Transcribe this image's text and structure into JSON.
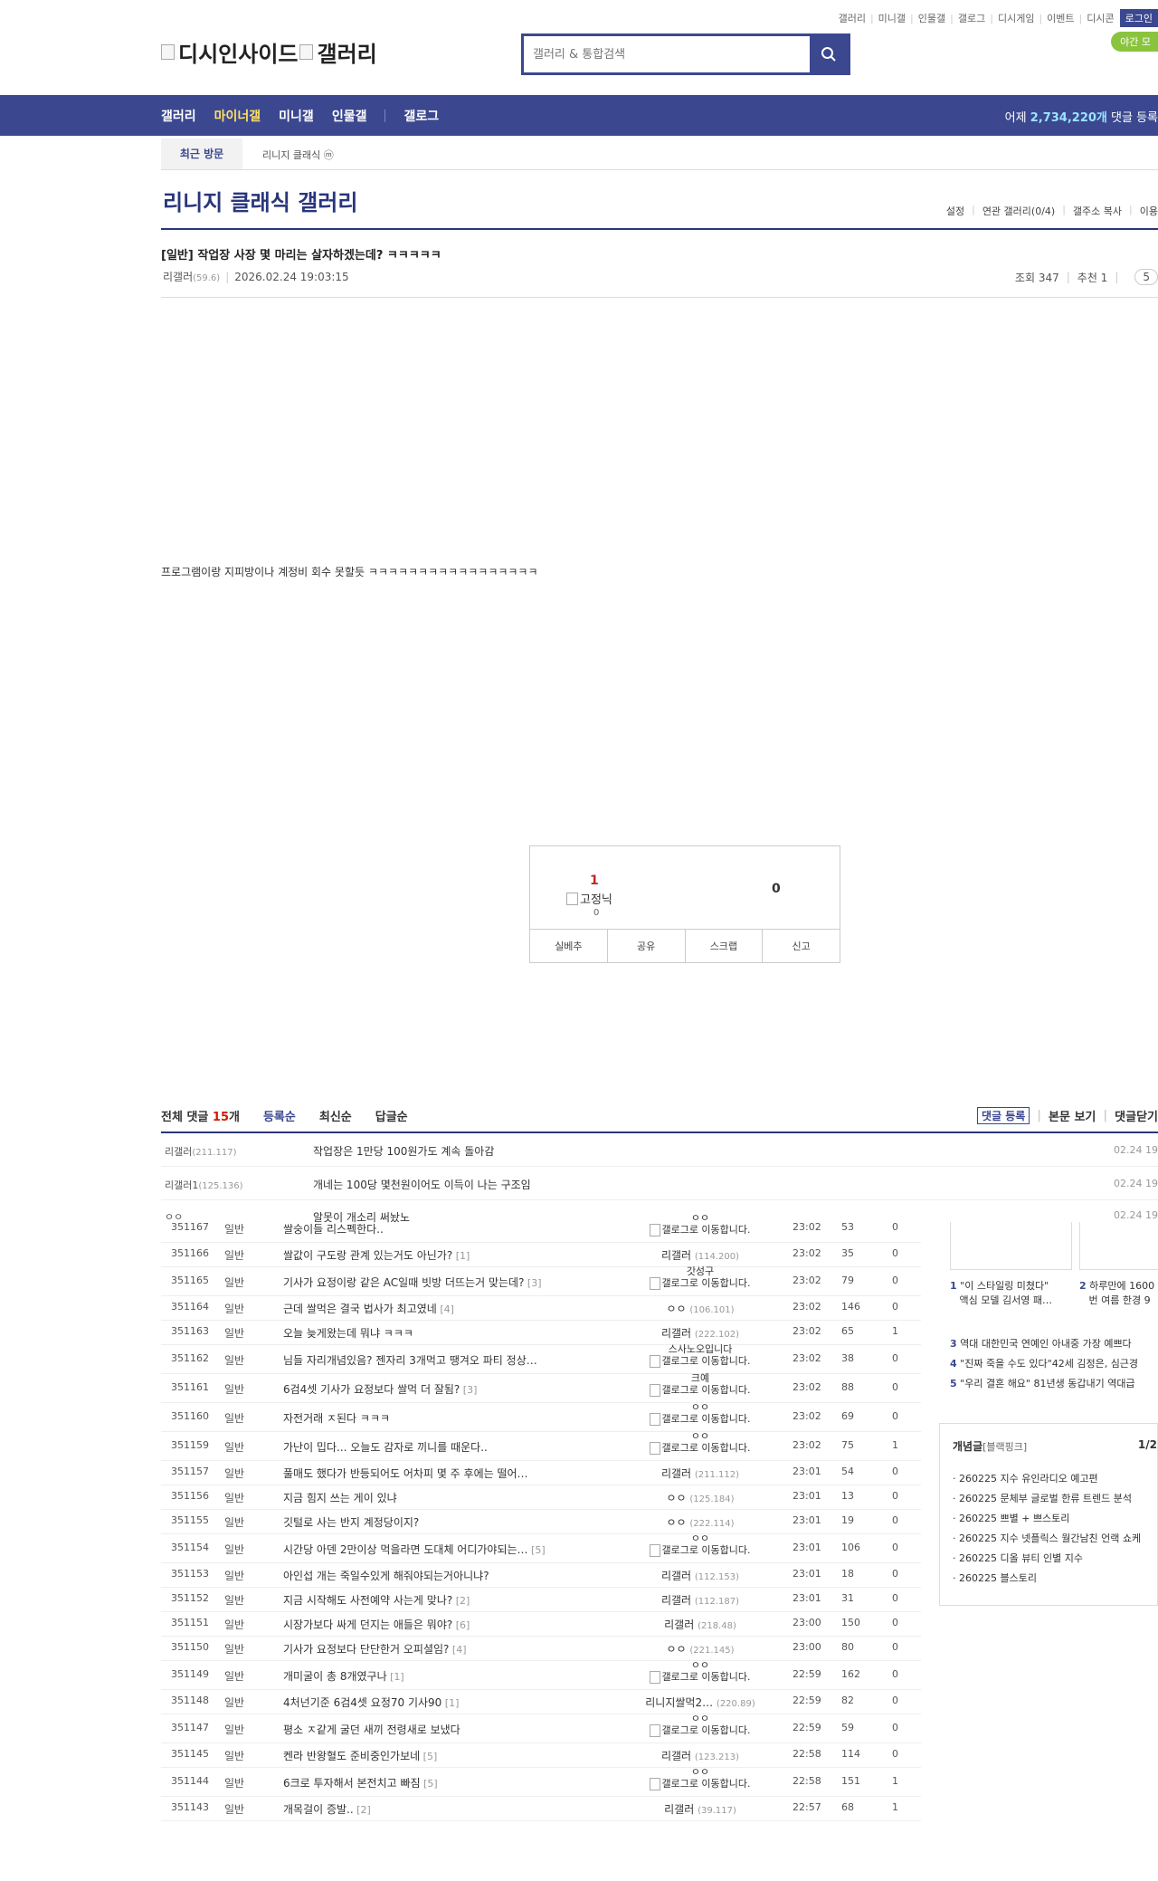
{
  "header": {
    "util_links": [
      "갤러리",
      "미니갤",
      "인물갤",
      "갤로그",
      "디시게임",
      "이벤트",
      "디시콘"
    ],
    "login_label": "로그인",
    "night_mode_label": "야간 모",
    "logo_left": "디시인사이드",
    "logo_right": "갤러리",
    "search_placeholder": "갤러리 & 통합검색"
  },
  "gnb": {
    "items": [
      "갤러리",
      "마이너갤",
      "미니갤",
      "인물갤",
      "갤로그"
    ],
    "stats_prefix": "어제",
    "stats_value": "2,734,220개",
    "stats_suffix": "댓글 등록"
  },
  "recent": {
    "label": "최근 방문",
    "item": "리니지 클래식",
    "item_badge": "ⓜ"
  },
  "gallery": {
    "title": "리니지 클래식 갤러리",
    "menu": [
      "설정",
      "연관 갤러리(0/4)",
      "갤주소 복사",
      "이용"
    ]
  },
  "post": {
    "title": "[일반] 작업장 사장 몇 마리는 살자하겠는데? ㅋㅋㅋㅋㅋ",
    "author": "리갤러",
    "author_ip": "(59.6)",
    "date": "2026.02.24 19:03:15",
    "views": "조회 347",
    "recommend": "추천 1",
    "comment_count_badge": "5",
    "body": "프로그램이랑 지피방이나 계정비 회수 못할듯 ㅋㅋㅋㅋㅋㅋㅋㅋㅋㅋㅋㅋㅋㅋㅋㅋㅋ"
  },
  "vote": {
    "up": "1",
    "fixed_label": "고정닉",
    "fixed_count": "0",
    "down": "0",
    "buttons": [
      "실베추",
      "공유",
      "스크랩",
      "신고"
    ]
  },
  "comments": {
    "total_prefix": "전체 댓글",
    "total_count": "15",
    "total_suffix": "개",
    "sorts": [
      "등록순",
      "최신순",
      "답글순"
    ],
    "actions": [
      "댓글 등록",
      "본문 보기",
      "댓글닫기"
    ],
    "items": [
      {
        "nick": "리갤러",
        "ip": "(211.117)",
        "text": "작업장은 1만당 100원가도 계속 돌아감",
        "date": "02.24 19"
      },
      {
        "nick": "리갤러1",
        "ip": "(125.136)",
        "text": "개네는 100당 몇천원이어도 이득이 나는 구조임",
        "date": "02.24 19"
      },
      {
        "nick": "ㅇㅇ",
        "ip": "",
        "text": "알못이 개소리 써놨노",
        "date": "02.24 19"
      }
    ]
  },
  "post_list": [
    {
      "no": "351167",
      "head": "일반",
      "subject": "쌀숭이들 리스펙한다..",
      "reply": "",
      "writer": "",
      "writer_ip": "",
      "gallog": "갤로그로 이동합니다.",
      "top": "ㅇㅇ",
      "time": "23:02",
      "views": "53",
      "rec": "0"
    },
    {
      "no": "351166",
      "head": "일반",
      "subject": "쌀값이 구도랑 관계 있는거도 아닌가?",
      "reply": "[1]",
      "writer": "리갤러",
      "writer_ip": "(114.200)",
      "gallog": "",
      "top": "",
      "time": "23:02",
      "views": "35",
      "rec": "0"
    },
    {
      "no": "351165",
      "head": "일반",
      "subject": "기사가 요정이랑 같은 AC일때 빗방 더뜨는거 맞는데?",
      "reply": "[3]",
      "writer": "",
      "writer_ip": "",
      "gallog": "갤로그로 이동합니다.",
      "top": "갓성구",
      "time": "23:02",
      "views": "79",
      "rec": "0"
    },
    {
      "no": "351164",
      "head": "일반",
      "subject": "근데 쌀먹은 결국 법사가 최고였네",
      "reply": "[4]",
      "writer": "ㅇㅇ",
      "writer_ip": "(106.101)",
      "gallog": "",
      "top": "",
      "time": "23:02",
      "views": "146",
      "rec": "0"
    },
    {
      "no": "351163",
      "head": "일반",
      "subject": "오늘 늦게왔는데 뭐냐 ㅋㅋㅋ",
      "reply": "",
      "writer": "리갤러",
      "writer_ip": "(222.102)",
      "gallog": "",
      "top": "",
      "time": "23:02",
      "views": "65",
      "rec": "1"
    },
    {
      "no": "351162",
      "head": "일반",
      "subject": "님들 자리개념있음? 젠자리 3개먹고 땡겨오 파티 정상…",
      "reply": "",
      "writer": "",
      "writer_ip": "",
      "gallog": "갤로그로 이동합니다.",
      "top": "스사노오입니다",
      "time": "23:02",
      "views": "38",
      "rec": "0"
    },
    {
      "no": "351161",
      "head": "일반",
      "subject": "6검4셋 기사가 요정보다 쌀먹 더 잘됨?",
      "reply": "[3]",
      "writer": "",
      "writer_ip": "",
      "gallog": "갤로그로 이동합니다.",
      "top": "크예",
      "time": "23:02",
      "views": "88",
      "rec": "0"
    },
    {
      "no": "351160",
      "head": "일반",
      "subject": "자전거래 ㅈ된다 ㅋㅋㅋ",
      "reply": "",
      "writer": "",
      "writer_ip": "",
      "gallog": "갤로그로 이동합니다.",
      "top": "ㅇㅇ",
      "time": "23:02",
      "views": "69",
      "rec": "0"
    },
    {
      "no": "351159",
      "head": "일반",
      "subject": "가난이 밉다... 오늘도 감자로 끼니를 때운다..",
      "reply": "",
      "writer": "",
      "writer_ip": "",
      "gallog": "갤로그로 이동합니다.",
      "top": "ㅇㅇ",
      "time": "23:02",
      "views": "75",
      "rec": "1"
    },
    {
      "no": "351157",
      "head": "일반",
      "subject": "풀매도 했다가 반등되어도 어차피 몇 주 후에는 떨어…",
      "reply": "",
      "writer": "리갤러",
      "writer_ip": "(211.112)",
      "gallog": "",
      "top": "",
      "time": "23:01",
      "views": "54",
      "rec": "0"
    },
    {
      "no": "351156",
      "head": "일반",
      "subject": "지금 힘지 쓰는 게이 있냐",
      "reply": "",
      "writer": "ㅇㅇ",
      "writer_ip": "(125.184)",
      "gallog": "",
      "top": "",
      "time": "23:01",
      "views": "13",
      "rec": "0"
    },
    {
      "no": "351155",
      "head": "일반",
      "subject": "깃털로 사는 반지 계정당이지?",
      "reply": "",
      "writer": "ㅇㅇ",
      "writer_ip": "(222.114)",
      "gallog": "",
      "top": "",
      "time": "23:01",
      "views": "19",
      "rec": "0"
    },
    {
      "no": "351154",
      "head": "일반",
      "subject": "시간당 아덴 2만이상 먹을라면 도대체 어디가야되는…",
      "reply": "[5]",
      "writer": "",
      "writer_ip": "",
      "gallog": "갤로그로 이동합니다.",
      "top": "ㅇㅇ",
      "time": "23:01",
      "views": "106",
      "rec": "0"
    },
    {
      "no": "351153",
      "head": "일반",
      "subject": "아인섭 개는 죽일수있게 해줘야되는거아니냐?",
      "reply": "",
      "writer": "리갤러",
      "writer_ip": "(112.153)",
      "gallog": "",
      "top": "",
      "time": "23:01",
      "views": "18",
      "rec": "0"
    },
    {
      "no": "351152",
      "head": "일반",
      "subject": "지금 시작해도 사전예약 사는게 맞나?",
      "reply": "[2]",
      "writer": "리갤러",
      "writer_ip": "(112.187)",
      "gallog": "",
      "top": "",
      "time": "23:01",
      "views": "31",
      "rec": "0"
    },
    {
      "no": "351151",
      "head": "일반",
      "subject": "시장가보다 싸게 던지는 애들은 뭐야?",
      "reply": "[6]",
      "writer": "리갤러",
      "writer_ip": "(218.48)",
      "gallog": "",
      "top": "",
      "time": "23:00",
      "views": "150",
      "rec": "0"
    },
    {
      "no": "351150",
      "head": "일반",
      "subject": "기사가 요정보다 단단한거 오피셜임?",
      "reply": "[4]",
      "writer": "ㅇㅇ",
      "writer_ip": "(221.145)",
      "gallog": "",
      "top": "",
      "time": "23:00",
      "views": "80",
      "rec": "0"
    },
    {
      "no": "351149",
      "head": "일반",
      "subject": "개미굴이 총 8개였구나",
      "reply": "[1]",
      "writer": "",
      "writer_ip": "",
      "gallog": "갤로그로 이동합니다.",
      "top": "ㅇㅇ",
      "time": "22:59",
      "views": "162",
      "rec": "0"
    },
    {
      "no": "351148",
      "head": "일반",
      "subject": "4처넌기준 6검4셋 요정70 기사90",
      "reply": "[1]",
      "writer": "리니지쌀먹2…",
      "writer_ip": "(220.89)",
      "gallog": "",
      "top": "",
      "time": "22:59",
      "views": "82",
      "rec": "0"
    },
    {
      "no": "351147",
      "head": "일반",
      "subject": "평소 ㅈ같게 굴던 새끼 전령새로 보냈다",
      "reply": "",
      "writer": "",
      "writer_ip": "",
      "gallog": "갤로그로 이동합니다.",
      "top": "ㅇㅇ",
      "time": "22:59",
      "views": "59",
      "rec": "0"
    },
    {
      "no": "351145",
      "head": "일반",
      "subject": "켄라 반왕혈도 준비중인가보네",
      "reply": "[5]",
      "writer": "리갤러",
      "writer_ip": "(123.213)",
      "gallog": "",
      "top": "",
      "time": "22:58",
      "views": "114",
      "rec": "0"
    },
    {
      "no": "351144",
      "head": "일반",
      "subject": "6크로 투자해서 본전치고 빠짐",
      "reply": "[5]",
      "writer": "",
      "writer_ip": "",
      "gallog": "갤로그로 이동합니다.",
      "top": "ㅇㅇ",
      "time": "22:58",
      "views": "151",
      "rec": "1"
    },
    {
      "no": "351143",
      "head": "일반",
      "subject": "개목걸이 증발..",
      "reply": "[2]",
      "writer": "리갤러",
      "writer_ip": "(39.117)",
      "gallog": "",
      "top": "",
      "time": "22:57",
      "views": "68",
      "rec": "1"
    }
  ],
  "side": {
    "ranks": [
      {
        "n": "1",
        "t": "\"이 스타일링 미쳤다\"",
        "t2": "액심 모델 김서영 패…"
      },
      {
        "n": "2",
        "t": "하루만에 1600",
        "t2": "번 여름 한경 9"
      },
      {
        "n": "3",
        "t": "역대 대한민국 연예인 아내중 가장 예쁘다"
      },
      {
        "n": "4",
        "t": "\"진짜 죽을 수도 있다\"42세 김정은, 심근경"
      },
      {
        "n": "5",
        "t": "\"우리 결혼 해요\" 81년생 동갑내기 역대급"
      }
    ],
    "concept_title": "개념글",
    "concept_sub": "[블랙핑크]",
    "concept_page": "1/2",
    "concept_items": [
      "260225 지수 유인라디오 예고편",
      "260225 문체부 글로벌 한류 트렌드 분석",
      "260225 쁘별 + 쁘스토리",
      "260225 지수 넷플릭스 월간남친 언랙 쇼케",
      "260225 디올 뷰티 인별 지수",
      "260225 블스토리"
    ]
  }
}
